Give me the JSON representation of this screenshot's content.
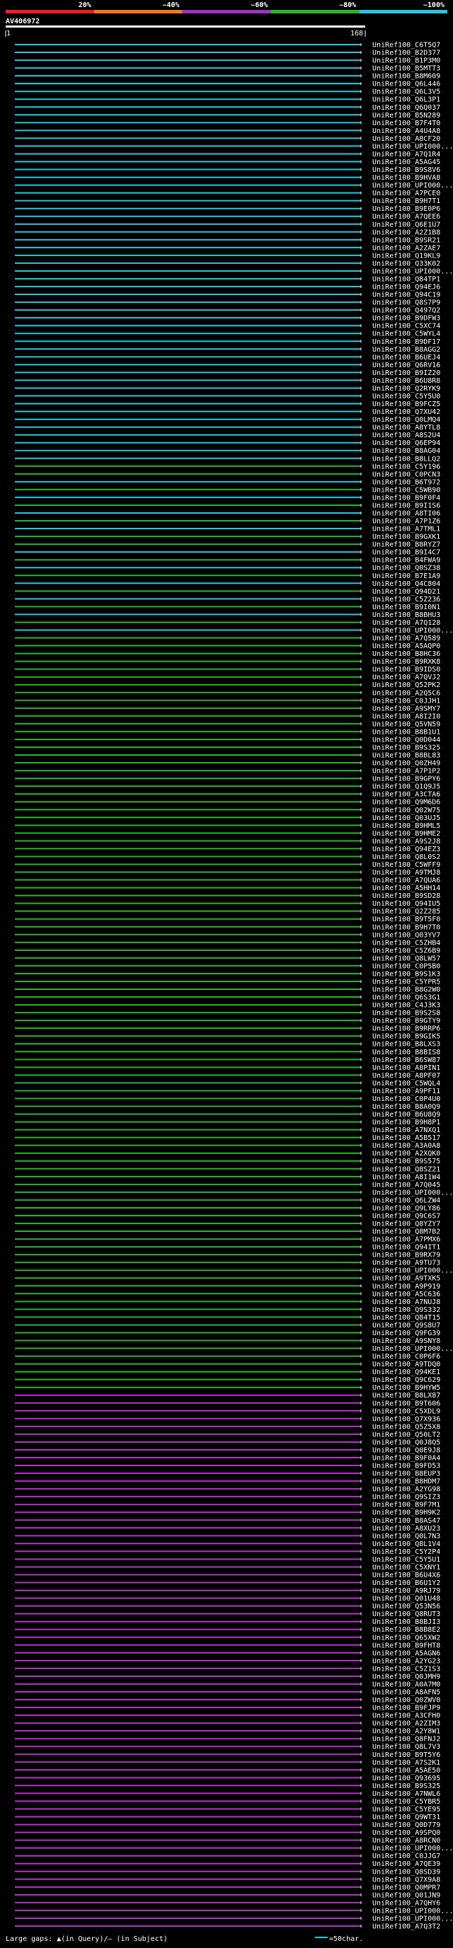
{
  "header": {
    "query_id": "AV406972",
    "range_start": "1",
    "range_end": "168",
    "color_scale": [
      {
        "label": "20%",
        "color": "#e8211f"
      },
      {
        "label": "~40%",
        "color": "#f07b1a"
      },
      {
        "label": "~60%",
        "color": "#a031c4"
      },
      {
        "label": "~80%",
        "color": "#2ab52a"
      },
      {
        "label": "~100%",
        "color": "#27c9dd"
      }
    ]
  },
  "footer": {
    "large_gaps_text": "Large gaps: ▲(in Query)/– (in Subject)",
    "scale_text": "=50char."
  },
  "chart_data": {
    "type": "alignment-overview",
    "query_length": 168,
    "hit_count": 260,
    "series_colors": {
      "cyan": "#27c9dd",
      "green": "#2ab52a",
      "magenta": "#b634c8"
    },
    "hits": [
      "UniRef100_C6T5Q7",
      "UniRef100_B2D377",
      "UniRef100_B1P3M0",
      "UniRef100_B5MTT3",
      "UniRef100_B8M609",
      "UniRef100_Q6L446",
      "UniRef100_Q6L3V5",
      "UniRef100_Q6L3P1",
      "UniRef100_Q6Q037",
      "UniRef100_B5N289",
      "UniRef100_B7F4T0",
      "UniRef100_A4U4A8",
      "UniRef100_A8CF20",
      "UniRef100_UPI000...",
      "UniRef100_A7Q1R4",
      "UniRef100_A5AG45",
      "UniRef100_B9S8V6",
      "UniRef100_B9HVA8",
      "UniRef100_UPI000...",
      "UniRef100_A7PCE0",
      "UniRef100_B9H7T1",
      "UniRef100_B9E0P6",
      "UniRef100_A7QEE6",
      "UniRef100_Q6E1U7",
      "UniRef100_A2Z1B8",
      "UniRef100_B9SR21",
      "UniRef100_A2ZAE7",
      "UniRef100_Q19KL9",
      "UniRef100_Q33K02",
      "UniRef100_UPI000...",
      "UniRef100_Q84TP1",
      "UniRef100_Q94EJ6",
      "UniRef100_Q94C19",
      "UniRef100_Q8S7P9",
      "UniRef100_Q497Q2",
      "UniRef100_B9DFW3",
      "UniRef100_C5XC74",
      "UniRef100_C5WYL4",
      "UniRef100_B9DF17",
      "UniRef100_B8AGG2",
      "UniRef100_B6UEJ4",
      "UniRef100_Q6RV16",
      "UniRef100_B9IZ20",
      "UniRef100_B6U8R8",
      "UniRef100_Q2RYK9",
      "UniRef100_C5Y5U0",
      "UniRef100_B9FCZ5",
      "UniRef100_Q7XU42",
      "UniRef100_Q0LMQ4",
      "UniRef100_A8YTL8",
      "UniRef100_A8S2U4",
      "UniRef100_Q6EP94",
      "UniRef100_B8AG04",
      "UniRef100_B8LLQ2",
      "UniRef100_C5Y196",
      "UniRef100_C0PCN3",
      "UniRef100_B6T972",
      "UniRef100_C5WB90",
      "UniRef100_B9F0F4",
      "UniRef100_B9I1S6",
      "UniRef100_A8TI06",
      "UniRef100_A7P1Z6",
      "UniRef100_A7TML1",
      "UniRef100_B9GXK1",
      "UniRef100_B8RYZ7",
      "UniRef100_B9I4C7",
      "UniRef100_B4FWA9",
      "UniRef100_Q0SZ38",
      "UniRef100_B7E1A9",
      "UniRef100_Q4C804",
      "UniRef100_Q94D21",
      "UniRef100_C5Z236",
      "UniRef100_B9I0N1",
      "UniRef100_B8BHU3",
      "UniRef100_A7Q128",
      "UniRef100_UPI000...",
      "UniRef100_A7Q589",
      "UniRef100_A5AQP0",
      "UniRef100_B8HC36",
      "UniRef100_B9RXK8",
      "UniRef100_B9IDS0",
      "UniRef100_A7QVJ2",
      "UniRef100_Q52PK2",
      "UniRef100_A2Q5C6",
      "UniRef100_C0JJH1",
      "UniRef100_A9SMY7",
      "UniRef100_A8I2I0",
      "UniRef100_Q5VN59",
      "UniRef100_B8B1U1",
      "UniRef100_Q0D044",
      "UniRef100_B9S325",
      "UniRef100_B8BL83",
      "UniRef100_Q0ZH49",
      "UniRef100_A7P1P2",
      "UniRef100_B9GPY6",
      "UniRef100_Q1Q9J5",
      "UniRef100_A3CTA6",
      "UniRef100_Q9M6D6",
      "UniRef100_Q02W75",
      "UniRef100_Q03UJ5",
      "UniRef100_B9HML5",
      "UniRef100_B9HME2",
      "UniRef100_A9S2J8",
      "UniRef100_Q94EZ3",
      "UniRef100_Q8L0S2",
      "UniRef100_C5WFF9",
      "UniRef100_A9TMJ8",
      "UniRef100_A7QUA6",
      "UniRef100_A5HH14",
      "UniRef100_B9SD28",
      "UniRef100_Q94IU5",
      "UniRef100_Q2Z285",
      "UniRef100_B9T5F0",
      "UniRef100_B9H7T0",
      "UniRef100_Q03YV7",
      "UniRef100_C5ZHB4",
      "UniRef100_C5Z6B9",
      "UniRef100_Q8LW57",
      "UniRef100_C0P5B0",
      "UniRef100_B9S1K3",
      "UniRef100_C5YPR5",
      "UniRef100_B8G2W0",
      "UniRef100_Q6S3G1",
      "UniRef100_C4J3K3",
      "UniRef100_B9S2S8",
      "UniRef100_B9GTY9",
      "UniRef100_B9RRP6",
      "UniRef100_B9GIK5",
      "UniRef100_B8LXS3",
      "UniRef100_B8BIS8",
      "UniRef100_B6SW87",
      "UniRef100_A8PIN1",
      "UniRef100_A8PF07",
      "UniRef100_C5WQL4",
      "UniRef100_A9PF11",
      "UniRef100_C0P4U0",
      "UniRef100_B8A0Q9",
      "UniRef100_B6U8Q9",
      "UniRef100_B9H8P1",
      "UniRef100_A7NXQ1",
      "UniRef100_A5B517",
      "UniRef100_A3A0A8",
      "UniRef100_A2XQK0",
      "UniRef100_B9S575",
      "UniRef100_Q8SZ21",
      "UniRef100_A8I1W4",
      "UniRef100_A7Q045",
      "UniRef100_UPI000...",
      "UniRef100_Q6LZW4",
      "UniRef100_Q9LY86",
      "UniRef100_Q9C6S7",
      "UniRef100_Q8YZY7",
      "UniRef100_Q8M7B2",
      "UniRef100_A7PMX6",
      "UniRef100_Q94IT1",
      "UniRef100_B9RX79",
      "UniRef100_A9TU73",
      "UniRef100_UPI000...",
      "UniRef100_A9TXK5",
      "UniRef100_A9P919",
      "UniRef100_A5C636",
      "UniRef100_A7NUJ8",
      "UniRef100_Q9S332",
      "UniRef100_Q84T15",
      "UniRef100_Q9S8U7",
      "UniRef100_Q9FG39",
      "UniRef100_A9SNY8",
      "UniRef100_UPI000...",
      "UniRef100_C0P6F6",
      "UniRef100_A9TDQ0",
      "UniRef100_Q94KE1",
      "UniRef100_Q9C629",
      "UniRef100_B9HYW5",
      "UniRef100_B8LX87",
      "UniRef100_B9T606",
      "UniRef100_C5XDL9",
      "UniRef100_Q7X936",
      "UniRef100_Q5Z5X8",
      "UniRef100_Q50LT2",
      "UniRef100_Q0J8Q5",
      "UniRef100_Q0E9J8",
      "UniRef100_B9F0A4",
      "UniRef100_B9FD53",
      "UniRef100_B8EUP3",
      "UniRef100_B8HDM7",
      "UniRef100_A2YG98",
      "UniRef100_Q9SIZ3",
      "UniRef100_B9F7M1",
      "UniRef100_B9H9K2",
      "UniRef100_B8AS47",
      "UniRef100_A8XU23",
      "UniRef100_Q0L7N3",
      "UniRef100_Q8L1V4",
      "UniRef100_C5Y2P4",
      "UniRef100_C5Y5U1",
      "UniRef100_C5XNY1",
      "UniRef100_B6U4X6",
      "UniRef100_B6U1Y2",
      "UniRef100_A9RJ79",
      "UniRef100_Q01U48",
      "UniRef100_Q53N56",
      "UniRef100_Q8RUT3",
      "UniRef100_B8BJI3",
      "UniRef100_B8B8E2",
      "UniRef100_Q65XW2",
      "UniRef100_B9FHT8",
      "UniRef100_A5AGN6",
      "UniRef100_A2YG23",
      "UniRef100_C5Z1S3",
      "UniRef100_Q0JMH9",
      "UniRef100_A0A7M0",
      "UniRef100_A8AFN5",
      "UniRef100_Q0ZWV0",
      "UniRef100_B9FJP9",
      "UniRef100_A3CFH0",
      "UniRef100_A2ZIM3",
      "UniRef100_A2Y8W1",
      "UniRef100_Q8FNJ2",
      "UniRef100_Q8L7V3",
      "UniRef100_B9T5Y6",
      "UniRef100_A7S2K1",
      "UniRef100_A5AE50",
      "UniRef100_Q93695",
      "UniRef100_B9S325",
      "UniRef100_A7NWL6",
      "UniRef100_C5YBR5",
      "UniRef100_C5YE95",
      "UniRef100_Q9WT31",
      "UniRef100_Q0D779",
      "UniRef100_A9SPQ0",
      "UniRef100_A8RCN0",
      "UniRef100_UPI000...",
      "UniRef100_C0JJG7",
      "UniRef100_A7QE39",
      "UniRef100_Q8SD39",
      "UniRef100_Q7X9A8",
      "UniRef100_Q0MPR7",
      "UniRef100_Q01JN9",
      "UniRef100_A7QHY6",
      "UniRef100_UPI000...",
      "UniRef100_UPI000...",
      "UniRef100_A7Q3T2"
    ],
    "color_bands": [
      {
        "color": "cyan",
        "from": 0,
        "to": 54
      },
      {
        "color": "green",
        "from": 54,
        "to": 173
      },
      {
        "color": "magenta",
        "from": 173,
        "to": 260
      }
    ],
    "interleaved_cyan_rows": [
      56,
      58,
      60,
      62,
      65,
      67,
      69,
      71,
      73,
      75
    ]
  }
}
